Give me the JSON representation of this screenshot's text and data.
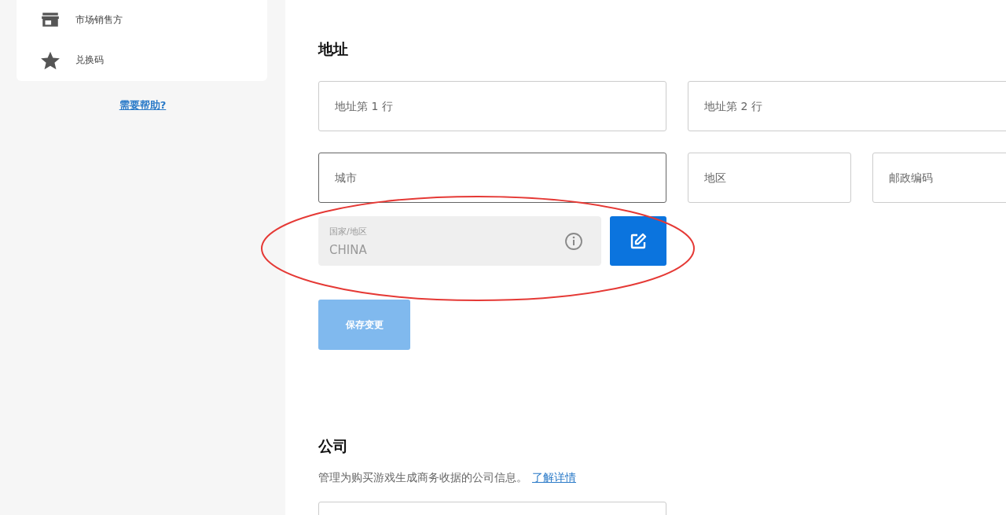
{
  "sidebar": {
    "items": [
      {
        "label": "市场销售方",
        "kind": "store"
      },
      {
        "label": "兑换码",
        "kind": "star"
      }
    ],
    "help_link": "需要帮助?"
  },
  "address": {
    "title": "地址",
    "rows": [
      [
        {
          "placeholder": "地址第 1 行",
          "focused": false
        },
        {
          "placeholder": "地址第 2 行",
          "focused": false
        }
      ],
      [
        {
          "placeholder": "城市",
          "focused": true
        },
        {
          "placeholder": "地区",
          "focused": false
        },
        {
          "placeholder": "邮政编码",
          "focused": false
        }
      ]
    ],
    "country": {
      "label": "国家/地区",
      "value": "CHINA",
      "disabled": true
    },
    "save_button": {
      "label": "保存变更",
      "disabled": true
    }
  },
  "company": {
    "title": "公司",
    "description": "管理为购买游戏生成商务收据的公司信息。",
    "link": "了解详情"
  }
}
